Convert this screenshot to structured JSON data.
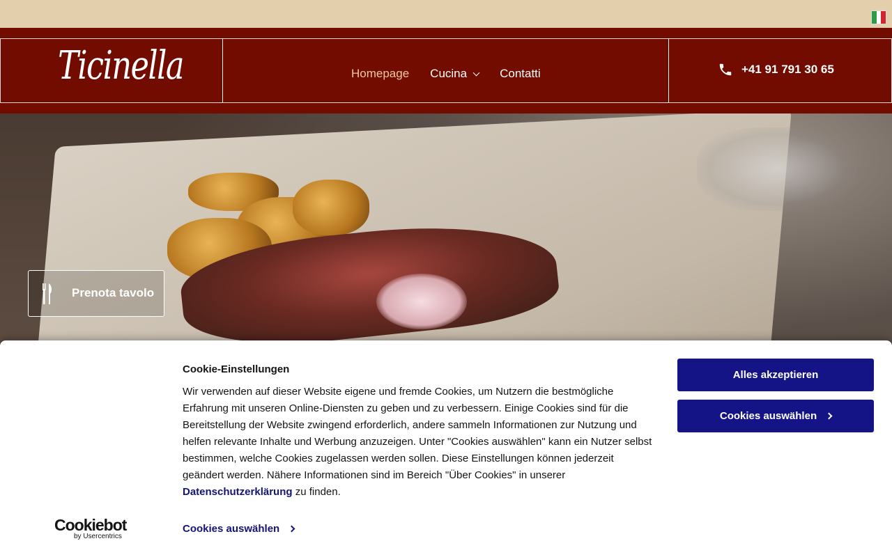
{
  "topbar": {
    "language_flag": "italian-flag-icon"
  },
  "header": {
    "logo_text": "Ticinella",
    "nav": [
      {
        "label": "Homepage",
        "active": true
      },
      {
        "label": "Cucina",
        "has_dropdown": true
      },
      {
        "label": "Contatti"
      }
    ],
    "phone": "+41 91 791 30 65",
    "colors": {
      "header_bg": "#720c00",
      "topbar_bg": "#e3cfab",
      "active_nav": "#f2c9a0"
    }
  },
  "hero": {
    "book_button_label": "Prenota tavolo",
    "book_icon": "fork-knife-icon"
  },
  "cookie_banner": {
    "title": "Cookie-Einstellungen",
    "text_before_link": "Wir verwenden auf dieser Website eigene und fremde Cookies, um Nutzern die bestmögliche Erfahrung mit unseren Online-Diensten zu geben und zu verbessern. Einige Cookies sind für die Bereitstellung der Website zwingend erforderlich, andere sammeln Informationen zur Nutzung und helfen relevante Inhalte und Werbung anzuzeigen. Unter \"Cookies auswählen\" kann ein Nutzer selbst bestimmen, welche Cookies zugelassen werden sollen. Diese Einstellungen können jederzeit geändert werden. Nähere Informationen sind im Bereich \"Über Cookies\" in unserer ",
    "link_label": "Datenschutzerklärung",
    "text_after_link": " zu finden.",
    "logo_main": "Cookiebot",
    "logo_sub": "by Usercentrics",
    "details_link_label": "Cookies auswählen",
    "accept_all_label": "Alles akzeptieren",
    "select_cookies_label": "Cookies auswählen",
    "colors": {
      "button_bg": "#141487",
      "link": "#141475"
    }
  }
}
